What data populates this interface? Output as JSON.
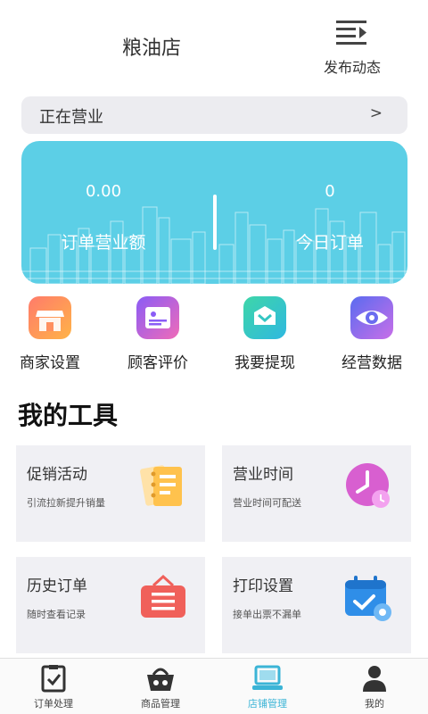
{
  "header": {
    "store_name": "粮油店",
    "publish_label": "发布动态"
  },
  "status": {
    "text": "正在营业",
    "arrow": ">"
  },
  "stats": {
    "order_revenue_value": "0.00",
    "order_revenue_label": "订单营业额",
    "today_orders_value": "0",
    "today_orders_label": "今日订单"
  },
  "quick_actions": [
    {
      "label": "商家设置",
      "icon": "storefront-icon"
    },
    {
      "label": "顾客评价",
      "icon": "id-card-icon"
    },
    {
      "label": "我要提现",
      "icon": "withdraw-icon"
    },
    {
      "label": "经营数据",
      "icon": "eye-icon"
    }
  ],
  "tools": {
    "title": "我的工具",
    "items": [
      {
        "title": "促销活动",
        "desc": "引流拉新提升销量",
        "icon": "promo-notebook-icon"
      },
      {
        "title": "营业时间",
        "desc": "营业时间可配送",
        "icon": "clock-icon"
      },
      {
        "title": "历史订单",
        "desc": "随时查看记录",
        "icon": "order-board-icon"
      },
      {
        "title": "打印设置",
        "desc": "接单出票不漏单",
        "icon": "calendar-gear-icon"
      }
    ]
  },
  "tabbar": {
    "items": [
      {
        "label": "订单处理",
        "icon": "order-check-icon",
        "active": false
      },
      {
        "label": "商品管理",
        "icon": "basket-icon",
        "active": false
      },
      {
        "label": "店铺管理",
        "icon": "laptop-icon",
        "active": true
      },
      {
        "label": "我的",
        "icon": "user-icon",
        "active": false
      }
    ]
  },
  "colors": {
    "accent": "#3bb4d6",
    "card_bg": "#5ccfe6",
    "tile_bg": "#f0f0f4"
  }
}
